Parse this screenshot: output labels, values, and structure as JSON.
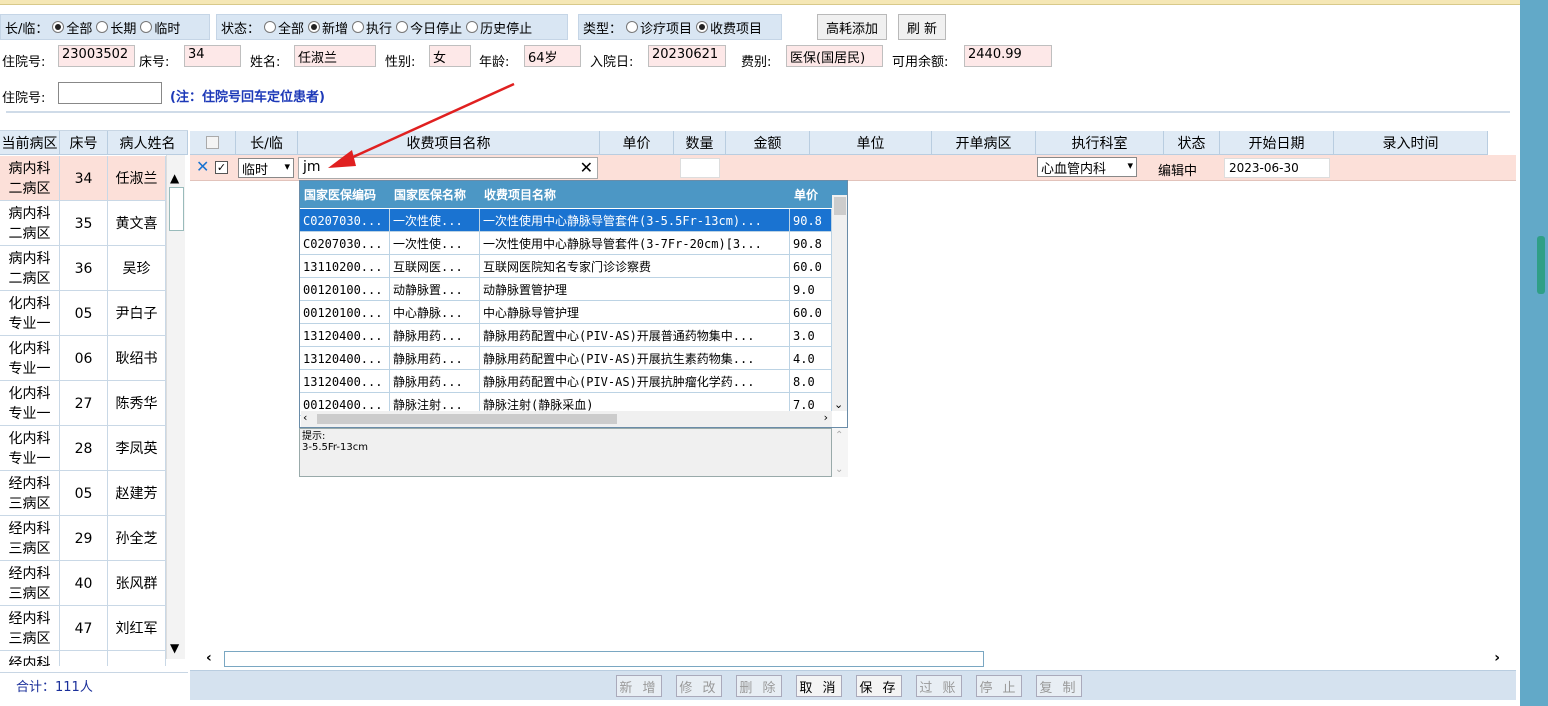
{
  "filters": {
    "type_label": "长/临：",
    "type_options": [
      {
        "label": "全部",
        "on": true
      },
      {
        "label": "长期",
        "on": false
      },
      {
        "label": "临时",
        "on": false
      }
    ],
    "status_label": "状态：",
    "status_options": [
      {
        "label": "全部",
        "on": false
      },
      {
        "label": "新增",
        "on": true
      },
      {
        "label": "执行",
        "on": false
      },
      {
        "label": "今日停止",
        "on": false
      },
      {
        "label": "历史停止",
        "on": false
      }
    ],
    "category_label": "类型：",
    "category_options": [
      {
        "label": "诊疗项目",
        "on": false
      },
      {
        "label": "收费项目",
        "on": true
      }
    ],
    "btn_high_value": "高耗添加",
    "btn_refresh": "刷 新"
  },
  "patient": {
    "admission_no_label": "住院号:",
    "admission_no": "23003502",
    "bed_label": "床号:",
    "bed": "34",
    "name_label": "姓名:",
    "name": "任淑兰",
    "sex_label": "性别:",
    "sex": "女",
    "age_label": "年龄:",
    "age": "64岁",
    "admit_date_label": "入院日:",
    "admit_date": "20230621",
    "fee_type_label": "费别:",
    "fee_type": "医保(国居民)",
    "balance_label": "可用余额:",
    "balance": "2440.99"
  },
  "search": {
    "label": "住院号:",
    "value": "",
    "note": "(注：住院号回车定位患者)"
  },
  "left_table": {
    "headers": [
      "当前病区",
      "床号",
      "病人姓名"
    ],
    "rows": [
      {
        "ward": "病内科二病区",
        "bed": "34",
        "name": "任淑兰",
        "selected": true
      },
      {
        "ward": "病内科二病区",
        "bed": "35",
        "name": "黄文喜"
      },
      {
        "ward": "病内科二病区",
        "bed": "36",
        "name": "吴珍"
      },
      {
        "ward": "化内科专业一",
        "bed": "05",
        "name": "尹白子"
      },
      {
        "ward": "化内科专业一",
        "bed": "06",
        "name": "耿绍书"
      },
      {
        "ward": "化内科专业一",
        "bed": "27",
        "name": "陈秀华"
      },
      {
        "ward": "化内科专业一",
        "bed": "28",
        "name": "李凤英"
      },
      {
        "ward": "经内科三病区",
        "bed": "05",
        "name": "赵建芳"
      },
      {
        "ward": "经内科三病区",
        "bed": "29",
        "name": "孙全芝"
      },
      {
        "ward": "经内科三病区",
        "bed": "40",
        "name": "张风群"
      },
      {
        "ward": "经内科三病区",
        "bed": "47",
        "name": "刘红军"
      },
      {
        "ward": "经内科监",
        "bed": "",
        "name": ""
      }
    ],
    "total": "合计：111人"
  },
  "main_table": {
    "headers": [
      "长/临",
      "收费项目名称",
      "单价",
      "数量",
      "金额",
      "单位",
      "开单病区",
      "执行科室",
      "状态",
      "开始日期",
      "录入时间"
    ],
    "edit_row": {
      "type_value": "临时",
      "item_input": "jm",
      "dept": "心血管内科",
      "status": "编辑中",
      "start_date": "2023-06-30"
    }
  },
  "dropdown": {
    "headers": [
      "国家医保编码",
      "国家医保名称",
      "收费项目名称",
      "单价"
    ],
    "rows": [
      [
        "C0207030...",
        "一次性使...",
        "一次性使用中心静脉导管套件(3-5.5Fr-13cm)...",
        "90.8"
      ],
      [
        "C0207030...",
        "一次性使...",
        "一次性使用中心静脉导管套件(3-7Fr-20cm)[3...",
        "90.8"
      ],
      [
        "13110200...",
        "互联网医...",
        "互联网医院知名专家门诊诊察费",
        "60.0"
      ],
      [
        "00120100...",
        "动静脉置...",
        "动静脉置管护理",
        "9.0"
      ],
      [
        "00120100...",
        "中心静脉...",
        "中心静脉导管护理",
        "60.0"
      ],
      [
        "13120400...",
        "静脉用药...",
        "静脉用药配置中心(PIV-AS)开展普通药物集中...",
        "3.0"
      ],
      [
        "13120400...",
        "静脉用药...",
        "静脉用药配置中心(PIV-AS)开展抗生素药物集...",
        "4.0"
      ],
      [
        "13120400...",
        "静脉用药...",
        "静脉用药配置中心(PIV-AS)开展抗肿瘤化学药...",
        "8.0"
      ],
      [
        "00120400...",
        "静脉注射...",
        "静脉注射(静脉采血)",
        "7.0"
      ]
    ],
    "tip_label": "提示:",
    "tip_text": "3-5.5Fr-13cm"
  },
  "actions": [
    "新 增",
    "修 改",
    "删 除",
    "取 消",
    "保 存",
    "过 账",
    "停 止",
    "复 制"
  ],
  "actions_enabled": [
    false,
    false,
    false,
    true,
    true,
    false,
    false,
    false
  ],
  "colors": {
    "accent": "#1a73d1",
    "header_bg": "#dfeaf5",
    "edit_row_bg": "#fce0d9",
    "arrow": "#e02020"
  }
}
